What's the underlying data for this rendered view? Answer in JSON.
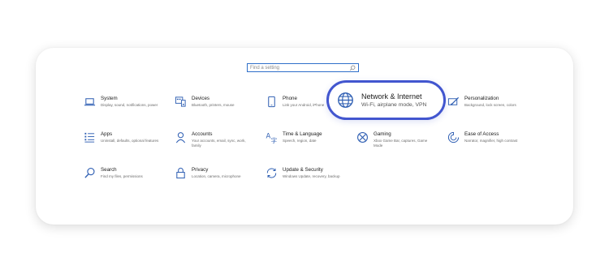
{
  "search": {
    "placeholder": "Find a setting"
  },
  "colors": {
    "icon": "#2f5fb3",
    "highlight": "#4256cf"
  },
  "items": [
    {
      "title": "System",
      "desc": "Display, sound, notifications, power",
      "icon": "laptop-icon"
    },
    {
      "title": "Devices",
      "desc": "Bluetooth, printers, mouse",
      "icon": "devices-icon"
    },
    {
      "title": "Phone",
      "desc": "Link your Android, iPhone",
      "icon": "phone-icon"
    },
    {
      "title": "Personalization",
      "desc": "Background, lock screen, colors",
      "icon": "paint-icon"
    },
    {
      "title": "Apps",
      "desc": "Uninstall, defaults, optional features",
      "icon": "apps-list-icon"
    },
    {
      "title": "Accounts",
      "desc": "Your accounts, email, sync, work, family",
      "icon": "person-icon"
    },
    {
      "title": "Time & Language",
      "desc": "Speech, region, date",
      "icon": "time-language-icon"
    },
    {
      "title": "Gaming",
      "desc": "Xbox Game Bar, captures, Game Mode",
      "icon": "xbox-icon"
    },
    {
      "title": "Ease of Access",
      "desc": "Narrator, magnifier, high contrast",
      "icon": "ease-of-access-icon"
    },
    {
      "title": "Search",
      "desc": "Find my files, permissions",
      "icon": "search-icon"
    },
    {
      "title": "Privacy",
      "desc": "Location, camera, microphone",
      "icon": "lock-icon"
    },
    {
      "title": "Update & Security",
      "desc": "Windows Update, recovery, backup",
      "icon": "sync-icon"
    }
  ],
  "highlighted": {
    "title": "Network & Internet",
    "desc": "Wi-Fi, airplane mode, VPN",
    "icon": "globe-icon"
  }
}
